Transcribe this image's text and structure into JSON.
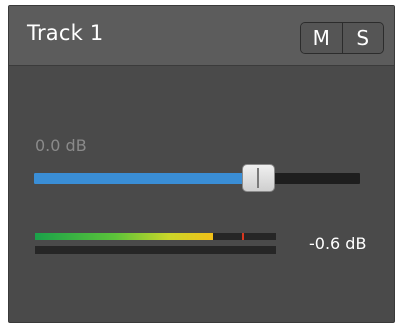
{
  "track": {
    "title": "Track 1",
    "mute_label": "M",
    "solo_label": "S"
  },
  "gain": {
    "label": "0.0 dB",
    "slider_level": 0.69
  },
  "meter": {
    "readout": "-0.6 dB",
    "level": 0.74,
    "peak": 0.86
  },
  "colors": {
    "panel_bg": "#4a4a4a",
    "header_bg": "#5c5c5c",
    "slider_fill": "#3a8ed6",
    "meter_green": "#1aa14a",
    "meter_yellow": "#f2c018",
    "peak_red": "#d9371f"
  }
}
